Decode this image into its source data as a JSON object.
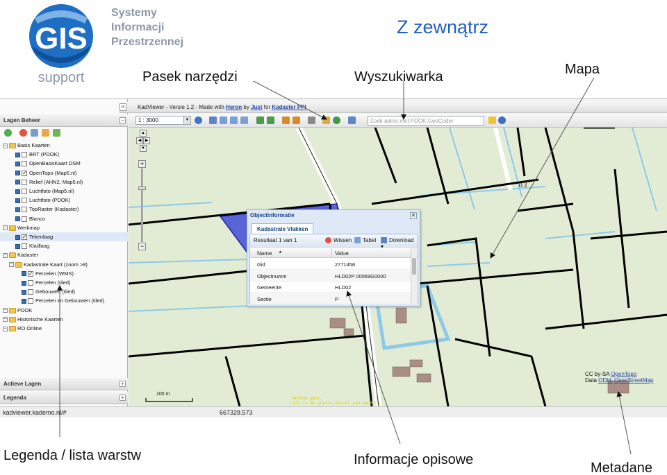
{
  "brand": {
    "line1": "Systemy",
    "line2": "Informacji",
    "line3": "Przestrzennej",
    "logo_text": "GIS",
    "logo_sub": "support"
  },
  "slide_title": "Z zewnątrz",
  "callouts": {
    "toolbar": "Pasek narzędzi",
    "search": "Wyszukiwarka",
    "map": "Mapa",
    "legend": "Legenda / lista warstw",
    "info": "Informacje opisowe",
    "metadata": "Metadane"
  },
  "app": {
    "title_prefix": "KadViewer - Versie 1.2 - Made with",
    "title_heron": "Heron",
    "title_by": "by",
    "title_just": "Just",
    "title_for": "for",
    "title_kadaster": "Kadaster PPI",
    "scale_value": "1 : 3000",
    "search_placeholder": "Zoek adres met PDOK GeoCoder",
    "status_url": "kadviewer.kademo.nl/#",
    "status_coord": "667328.573"
  },
  "left_panel": {
    "header": "Lagen Beheer",
    "bottom1": "Actieve Lagen",
    "bottom2": "Legenda",
    "tree": [
      {
        "label": "Basis Kaarten",
        "kind": "folder",
        "indent": 0
      },
      {
        "label": "BRT (PDOK)",
        "kind": "layer",
        "indent": 2,
        "checked": false
      },
      {
        "label": "OpenBasisKaart OSM",
        "kind": "layer",
        "indent": 2,
        "checked": false
      },
      {
        "label": "OpenTopo (Map5.nl)",
        "kind": "layer",
        "indent": 2,
        "checked": true
      },
      {
        "label": "Relief (AHN2, Map5.nl)",
        "kind": "layer",
        "indent": 2,
        "checked": false
      },
      {
        "label": "Luchtfoto (Map5.nl)",
        "kind": "layer",
        "indent": 2,
        "checked": false
      },
      {
        "label": "Luchtfoto (PDOK)",
        "kind": "layer",
        "indent": 2,
        "checked": false
      },
      {
        "label": "TopRaster (Kadaster)",
        "kind": "layer",
        "indent": 2,
        "checked": false
      },
      {
        "label": "Blanco",
        "kind": "layer",
        "indent": 2,
        "checked": false
      },
      {
        "label": "Werkmap",
        "kind": "folder",
        "indent": 0
      },
      {
        "label": "Tekenlaag",
        "kind": "layer",
        "indent": 2,
        "checked": true,
        "selected": true
      },
      {
        "label": "Kladlaag",
        "kind": "layer",
        "indent": 2,
        "checked": false
      },
      {
        "label": "Kadaster",
        "kind": "folder",
        "indent": 0
      },
      {
        "label": "Kadastrale Kaart (zoom >8)",
        "kind": "folder",
        "indent": 1
      },
      {
        "label": "Percelen (WMS)",
        "kind": "layer",
        "indent": 3,
        "checked": true
      },
      {
        "label": "Percelen (tiled)",
        "kind": "layer",
        "indent": 3,
        "checked": false
      },
      {
        "label": "Gebouwen (tiled)",
        "kind": "layer",
        "indent": 3,
        "checked": false
      },
      {
        "label": "Percelen en Gebouwen (tiled)",
        "kind": "layer",
        "indent": 3,
        "checked": false
      },
      {
        "label": "PDOK",
        "kind": "folder",
        "indent": 0
      },
      {
        "label": "Historische Kaarten",
        "kind": "folder",
        "indent": 0
      },
      {
        "label": "RO Online",
        "kind": "folder",
        "indent": 0
      }
    ]
  },
  "object_info": {
    "window_title": "Objectinformatie",
    "tab": "Kadastrale Vlakken",
    "result": "Resultaat 1 van 1",
    "btn_clear": "Wissen",
    "btn_table": "Tabel",
    "btn_download": "Download",
    "col_name": "Name",
    "col_value": "Value",
    "rows": [
      {
        "name": "Gid",
        "value": "2771456"
      },
      {
        "name": "Objectnumm",
        "value": "HLD02P 00069G0000"
      },
      {
        "name": "Gemeente",
        "value": "HLD02"
      },
      {
        "name": "Sectie",
        "value": "P"
      }
    ]
  },
  "map": {
    "scalebar": "100 m",
    "parcel_label": "0.3",
    "attribution_1": "CC by-SA",
    "attribution_1_link": "OpenTopo",
    "attribution_2": "Data",
    "attribution_2_link1": "ODbL",
    "attribution_2_link2": "OpenStreetMap",
    "watermark_1": "Welkom gast,",
    "watermark_2": "dit is de gratis dienst van map5.nl"
  },
  "colors": {
    "title_blue": "#1f5fbf",
    "map_bg": "#e2ecd4",
    "parcel_line": "#000000",
    "water": "#8ec9e8",
    "selected_parcel": "#2838d8"
  }
}
